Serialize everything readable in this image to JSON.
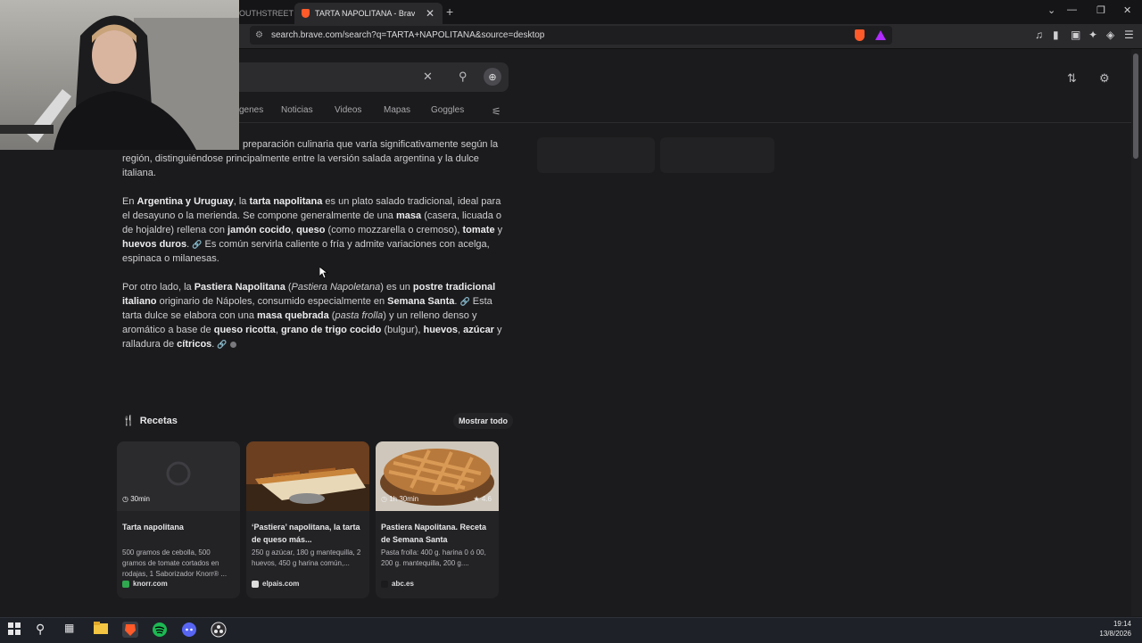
{
  "browser": {
    "tabs": [
      {
        "label": "OUTHSTREET D"
      },
      {
        "label": "TARTA NAPOLITANA - Brave Sea"
      }
    ],
    "new_tab": "+",
    "window_controls": {
      "minimize": "—",
      "restore": "❐",
      "close": "✕",
      "list": "⌄"
    },
    "url": "search.brave.com/search?q=TARTA+NAPOLITANA&source=desktop"
  },
  "search": {
    "nav": [
      "genes",
      "Noticias",
      "Videos",
      "Mapas",
      "Goggles"
    ]
  },
  "answer": {
    "p1": "preparación culinaria que varía significativamente según la región, distinguiéndose principalmente entre la versión salada argentina y la dulce italiana.",
    "p2": {
      "t1": "En ",
      "b1": "Argentina y Uruguay",
      "t2": ", la ",
      "b2": "tarta napolitana",
      "t3": " es un plato salado tradicional, ideal para el desayuno o la merienda. Se compone generalmente de una ",
      "b3": "masa",
      "t4": " (casera, licuada o de hojaldre) rellena con ",
      "b4": "jamón cocido",
      "t5": ", ",
      "b5": "queso",
      "t6": " (como mozzarella o cremoso), ",
      "b6": "tomate",
      "t7": " y ",
      "b7": "huevos duros",
      "t8": ". ",
      "cite": "⟋",
      "t9": " Es común servirla caliente o fría y admite variaciones con acelga, espinaca o milanesas."
    },
    "p3": {
      "t1": "Por otro lado, la ",
      "b1": "Pastiera Napolitana",
      "t2": " (",
      "i1": "Pastiera Napoletana",
      "t3": ") es un ",
      "b2": "postre tradicional italiano",
      "t4": " originario de Nápoles, consumido especialmente en ",
      "b3": "Semana Santa",
      "t5": ". ",
      "t6": " Esta tarta dulce se elabora con una ",
      "b4": "masa quebrada",
      "t7": " (",
      "i2": "pasta frolla",
      "t8": ") y un relleno denso y aromático a base de ",
      "b5": "queso ricotta",
      "t9": ", ",
      "b6": "grano de trigo cocido",
      "t10": " (bulgur), ",
      "b7": "huevos",
      "t11": ", ",
      "b8": "azúcar",
      "t12": " y ralladura de ",
      "b9": "cítricos",
      "t13": ". "
    }
  },
  "recipes": {
    "heading": "Recetas",
    "show_all": "Mostrar todo",
    "cards": [
      {
        "time": "30min",
        "rating": "",
        "title": "Tarta napolitana",
        "desc": "500 gramos de cebolla, 500 gramos de tomate cortados en rodajas, 1 Saborizador Knorr® ...",
        "source": "knorr.com",
        "source_color": "#2fa84f"
      },
      {
        "time": "",
        "rating": "",
        "title": "‘Pastiera’ napolitana, la tarta de queso más...",
        "desc": "250 g azúcar, 180 g mantequilla, 2 huevos, 450 g harina común,...",
        "source": "elpais.com",
        "source_color": "#dddddd"
      },
      {
        "time": "1h 30min",
        "rating": "4.6",
        "title": "Pastiera Napolitana. Receta de Semana Santa",
        "desc": "Pasta frolla: 400 g. harina 0 ó 00, 200 g. mantequilla, 200 g....",
        "source": "abc.es",
        "source_color": "#1b1b1d"
      }
    ]
  },
  "taskbar": {
    "time": "19:14",
    "date": "13/8/2026"
  }
}
